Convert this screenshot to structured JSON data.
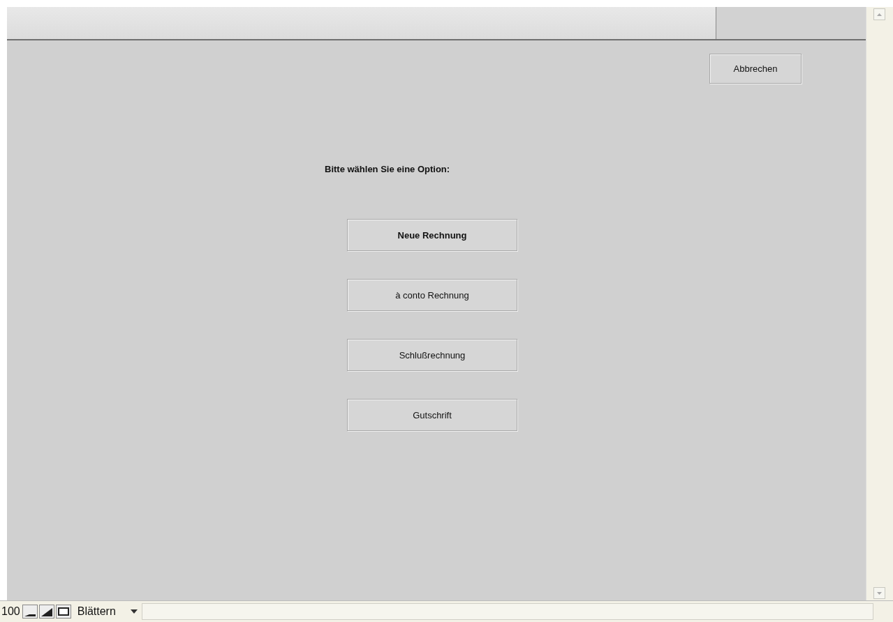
{
  "cancel_button": {
    "label": "Abbrechen"
  },
  "prompt": "Bitte wählen Sie eine Option:",
  "options": [
    {
      "label": "Neue Rechnung",
      "default": true
    },
    {
      "label": "à conto Rechnung",
      "default": false
    },
    {
      "label": "Schlußrechnung",
      "default": false
    },
    {
      "label": "Gutschrift",
      "default": false
    }
  ],
  "status_bar": {
    "zoom": "100",
    "mode": "Blättern"
  }
}
